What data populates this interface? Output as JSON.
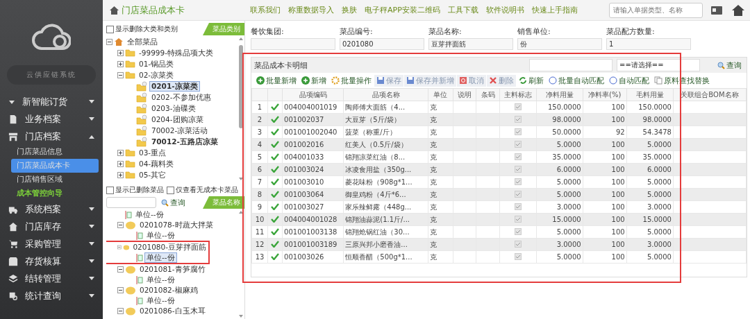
{
  "sidebar": {
    "brand": "云供应链系统",
    "items": [
      {
        "label": "新智能订货",
        "expanded": false
      },
      {
        "label": "业务档案",
        "expanded": false
      },
      {
        "label": "门店档案",
        "expanded": true,
        "children": [
          {
            "label": "门店菜品信息",
            "selected": false,
            "kind": "link"
          },
          {
            "label": "门店菜品成本卡",
            "selected": true,
            "kind": "link"
          },
          {
            "label": "门店销售区域",
            "selected": false,
            "kind": "link"
          },
          {
            "label": "成本管控向导",
            "selected": false,
            "kind": "guide"
          }
        ]
      },
      {
        "label": "系统档案",
        "expanded": false
      },
      {
        "label": "门店库存",
        "expanded": false
      },
      {
        "label": "采购管理",
        "expanded": false
      },
      {
        "label": "存货核算",
        "expanded": false
      },
      {
        "label": "结转管理",
        "expanded": false
      },
      {
        "label": "统计查询",
        "expanded": false
      }
    ]
  },
  "page_title": "门店菜品成本卡",
  "top_links": [
    "联系我们",
    "称重数据导入",
    "换肤",
    "电子秤APP安装二维码",
    "工具下载",
    "软件说明书",
    "快速上手指南"
  ],
  "top_search": {
    "placeholder": "请输入单据类型、名称"
  },
  "category_panel": {
    "show_deleted": {
      "label": "显示删除大类和类别",
      "checked": false
    },
    "tab": "菜品类别",
    "tree": [
      {
        "label": "全部菜品",
        "kind": "root",
        "expanded": true,
        "selected": false,
        "bold": false,
        "children": [
          {
            "label": "-99999-特殊品项大类",
            "kind": "folder",
            "expanded": false,
            "selected": false,
            "bold": false
          },
          {
            "label": "01-锅品类",
            "kind": "folder",
            "expanded": false,
            "selected": false,
            "bold": false
          },
          {
            "label": "02-凉菜类",
            "kind": "folder",
            "expanded": true,
            "selected": false,
            "bold": false,
            "children": [
              {
                "label": "0201-凉菜类",
                "kind": "leaf",
                "selected": true,
                "bold": true
              },
              {
                "label": "0202-不参加优惠",
                "kind": "leaf",
                "selected": false,
                "bold": false
              },
              {
                "label": "0203-油碟类",
                "kind": "leaf",
                "selected": false,
                "bold": false
              },
              {
                "label": "0204-团购凉菜",
                "kind": "leaf",
                "selected": false,
                "bold": false
              },
              {
                "label": "70002-凉菜活动",
                "kind": "leaf",
                "selected": false,
                "bold": false
              },
              {
                "label": "70012-五路店凉菜",
                "kind": "leaf",
                "selected": false,
                "bold": true
              }
            ]
          },
          {
            "label": "03-重点",
            "kind": "folder",
            "expanded": false,
            "selected": false,
            "bold": false
          },
          {
            "label": "04-藕料类",
            "kind": "folder",
            "expanded": false,
            "selected": false,
            "bold": false
          },
          {
            "label": "05-其它",
            "kind": "folder",
            "expanded": false,
            "selected": false,
            "bold": false
          }
        ]
      }
    ]
  },
  "product_panel": {
    "show_deleted": {
      "label": "显示已删除菜品",
      "checked": false
    },
    "no_card_only": {
      "label": "仅查看无成本卡菜品",
      "checked": false
    },
    "search_button": "查询",
    "tab": "菜品名称",
    "tree": [
      {
        "label": "单位--份",
        "kind": "unit",
        "selected": false,
        "highlighted": false
      },
      {
        "label": "0201078-时蔬大拌菜",
        "kind": "dish",
        "expanded": true,
        "selected": false,
        "highlighted": false,
        "children": [
          {
            "label": "单位--份",
            "kind": "unit",
            "selected": false,
            "highlighted": false
          }
        ]
      },
      {
        "label": "0201080-豆芽拌面筋",
        "kind": "dish",
        "expanded": true,
        "selected": false,
        "highlighted": true,
        "children": [
          {
            "label": "单位--份",
            "kind": "unit",
            "selected": true,
            "highlighted": false
          }
        ]
      },
      {
        "label": "0201081-青笋腐竹",
        "kind": "dish",
        "expanded": true,
        "selected": false,
        "highlighted": false,
        "children": [
          {
            "label": "单位--份",
            "kind": "unit",
            "selected": false,
            "highlighted": false
          }
        ]
      },
      {
        "label": "0201082-椒麻鸡",
        "kind": "dish",
        "expanded": true,
        "selected": false,
        "highlighted": false,
        "children": [
          {
            "label": "单位--份",
            "kind": "unit",
            "selected": false,
            "highlighted": false
          }
        ]
      },
      {
        "label": "0201086-白玉木耳",
        "kind": "dish",
        "expanded": true,
        "selected": false,
        "highlighted": false
      }
    ]
  },
  "header_fields": [
    {
      "label": "餐饮集团:"
    },
    {
      "label": "菜品编号:",
      "value": "0201080"
    },
    {
      "label": "菜品名称:",
      "value": "豆芽拌面筋"
    },
    {
      "label": "销售单位:",
      "value": "份"
    },
    {
      "label": "菜品配方数量:",
      "value": "1"
    }
  ],
  "grid": {
    "title": "菜品成本卡明细",
    "highlighted": true,
    "filter_select": "==请选择==",
    "search_button": "查询",
    "toolbar": [
      {
        "label": "批量新增",
        "disabled": false
      },
      {
        "label": "新增",
        "disabled": false
      },
      {
        "label": "批量操作",
        "disabled": false
      },
      {
        "label": "保存",
        "disabled": true
      },
      {
        "label": "保存并新增",
        "disabled": true
      },
      {
        "label": "取消",
        "disabled": true
      },
      {
        "label": "删除",
        "disabled": true
      },
      {
        "label": "刷新",
        "disabled": false
      },
      {
        "label": "批量自动匹配",
        "disabled": false
      },
      {
        "label": "自动匹配",
        "disabled": false
      },
      {
        "label": "原料查找替换",
        "disabled": false
      }
    ],
    "columns": [
      "品项编码",
      "品项名称",
      "单位",
      "说明",
      "条码",
      "主料标志",
      "净料用量",
      "净料率(%)",
      "毛料用量",
      "关联组合BOM名称"
    ],
    "rows": [
      {
        "no": "1",
        "valid": true,
        "code": "004004001019",
        "name": "陶师傅大面筋（4...",
        "unit": "克",
        "main": true,
        "net": "150.0000",
        "rate": "100",
        "gross": "150.0000"
      },
      {
        "no": "2",
        "valid": true,
        "code": "001002037",
        "name": "大豆芽（5斤/袋）",
        "unit": "克",
        "main": true,
        "net": "98.0000",
        "rate": "100",
        "gross": "98.0000"
      },
      {
        "no": "3",
        "valid": true,
        "code": "001001002040",
        "name": "菠菜（称重/斤）",
        "unit": "克",
        "main": true,
        "net": "50.0000",
        "rate": "92",
        "gross": "54.3478"
      },
      {
        "no": "4",
        "valid": true,
        "code": "001002016",
        "name": "红美人（0.5斤/袋）",
        "unit": "克",
        "main": true,
        "net": "5.0000",
        "rate": "100",
        "gross": "5.0000"
      },
      {
        "no": "5",
        "valid": true,
        "code": "004001033",
        "name": "锦翔凉菜红油（8...",
        "unit": "克",
        "main": true,
        "net": "35.0000",
        "rate": "100",
        "gross": "35.0000"
      },
      {
        "no": "6",
        "valid": true,
        "code": "001003024",
        "name": "冰凌食用盐（350g...",
        "unit": "克",
        "main": true,
        "net": "6.0000",
        "rate": "100",
        "gross": "6.0000"
      },
      {
        "no": "7",
        "valid": true,
        "code": "001003010",
        "name": "菱花味粉（908g*1...",
        "unit": "克",
        "main": true,
        "net": "5.0000",
        "rate": "100",
        "gross": "5.0000"
      },
      {
        "no": "8",
        "valid": true,
        "code": "001003064",
        "name": "御皇鸡粉（4斤*6...",
        "unit": "克",
        "main": true,
        "net": "5.0000",
        "rate": "100",
        "gross": "5.0000"
      },
      {
        "no": "9",
        "valid": true,
        "code": "001003027",
        "name": "家乐辣鲜露（448g...",
        "unit": "克",
        "main": true,
        "net": "3.0000",
        "rate": "100",
        "gross": "3.0000"
      },
      {
        "no": "10",
        "valid": true,
        "code": "004004001028",
        "name": "锦翔油蒜泥(1.1斤/...",
        "unit": "克",
        "main": true,
        "net": "15.0000",
        "rate": "100",
        "gross": "15.0000"
      },
      {
        "no": "11",
        "valid": true,
        "code": "001001003138",
        "name": "锦翔炝锅红油（30...",
        "unit": "克",
        "main": true,
        "net": "5.0000",
        "rate": "100",
        "gross": "5.0000"
      },
      {
        "no": "12",
        "valid": true,
        "code": "001001003189",
        "name": "三原兴邦小磨香油...",
        "unit": "克",
        "main": true,
        "net": "3.0000",
        "rate": "100",
        "gross": "3.0000"
      },
      {
        "no": "13",
        "valid": true,
        "code": "001003026",
        "name": "恒顺香醋（500g*1...",
        "unit": "克",
        "main": true,
        "net": "5.0000",
        "rate": "100",
        "gross": "5.0000"
      }
    ]
  }
}
